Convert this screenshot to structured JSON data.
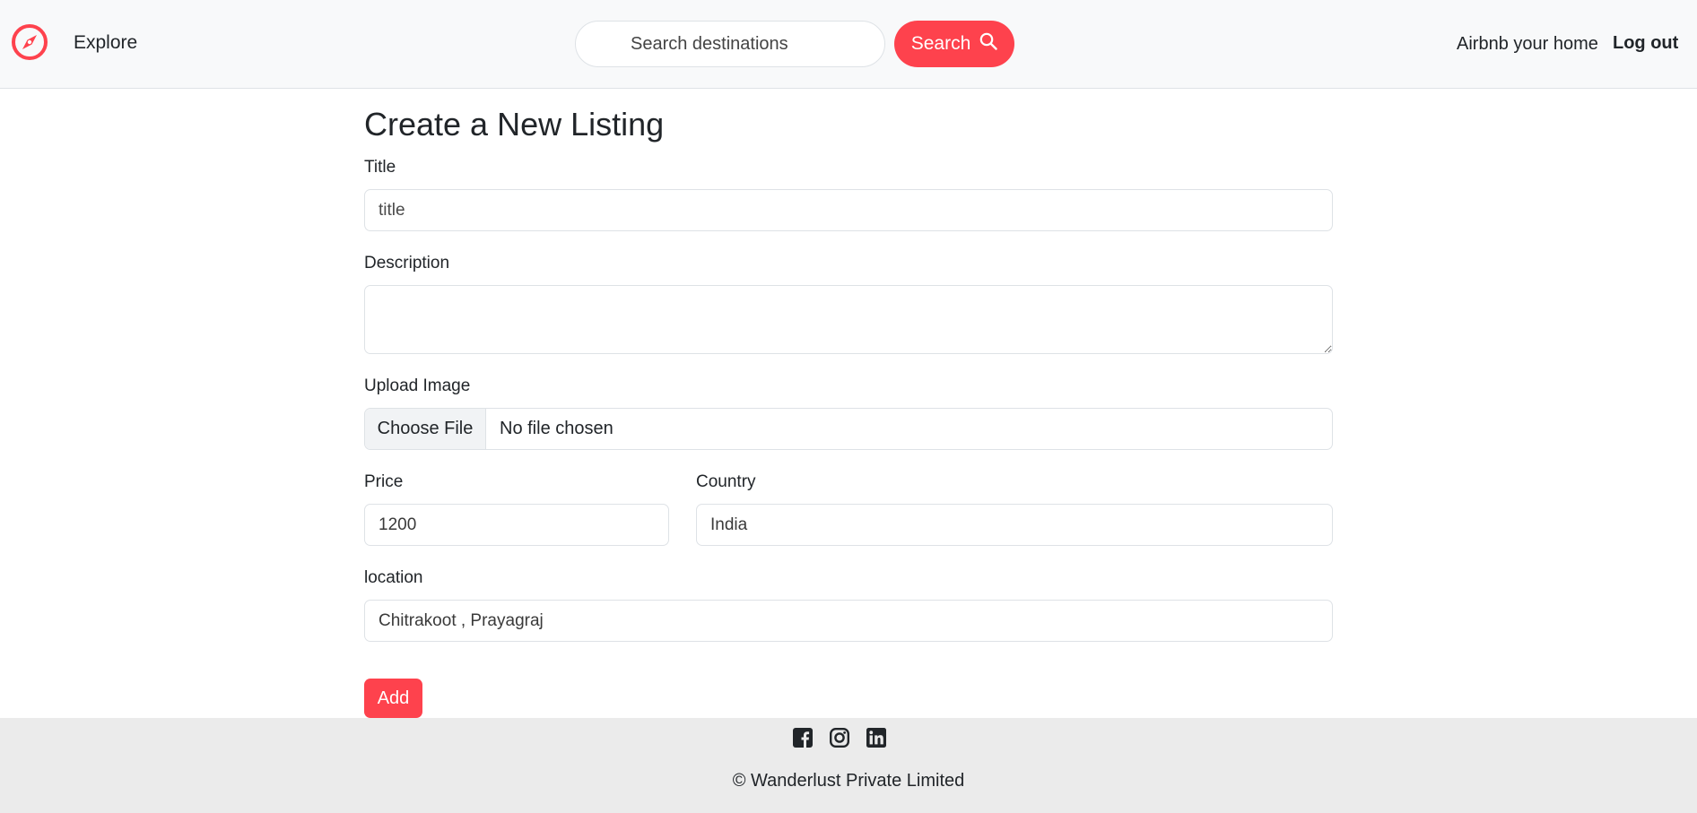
{
  "navbar": {
    "explore_label": "Explore",
    "search": {
      "placeholder": "Search destinations",
      "button_label": "Search"
    },
    "host_label": "Airbnb your home",
    "logout_label": "Log out"
  },
  "form": {
    "heading": "Create a New Listing",
    "title": {
      "label": "Title",
      "placeholder": "title",
      "value": ""
    },
    "description": {
      "label": "Description",
      "value": ""
    },
    "image": {
      "label": "Upload Image",
      "button_label": "Choose File",
      "status": "No file chosen"
    },
    "price": {
      "label": "Price",
      "value": "1200"
    },
    "country": {
      "label": "Country",
      "value": "India"
    },
    "location": {
      "label": "location",
      "value": "Chitrakoot , Prayagraj"
    },
    "submit_label": "Add"
  },
  "footer": {
    "copyright": "© Wanderlust Private Limited",
    "social_icons": [
      "facebook-icon",
      "instagram-icon",
      "linkedin-icon"
    ]
  },
  "colors": {
    "brand": "#fe424d",
    "navbar_bg": "#f8f9fa",
    "footer_bg": "#ebebeb"
  }
}
